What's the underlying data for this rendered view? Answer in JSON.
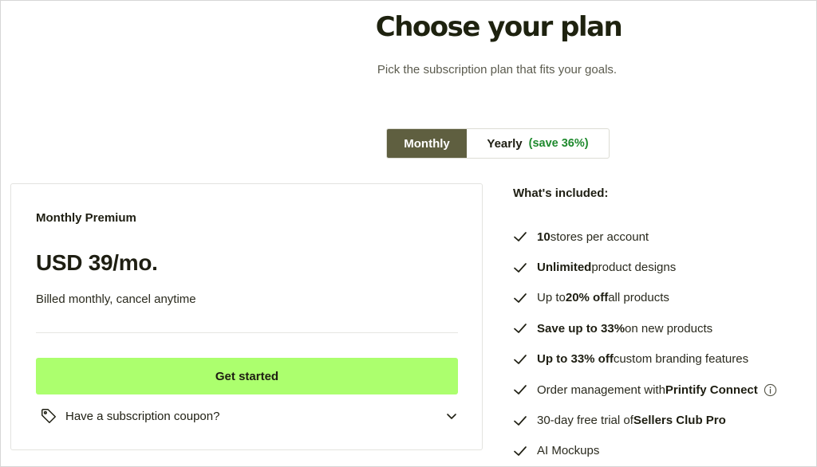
{
  "header": {
    "title": "Choose your plan",
    "subtitle": "Pick the subscription plan that fits your goals."
  },
  "billing_toggle": {
    "monthly_label": "Monthly",
    "yearly_label": "Yearly",
    "yearly_badge": "(save 36%)",
    "selected": "Monthly"
  },
  "plan": {
    "name": "Monthly Premium",
    "price": "USD 39/mo.",
    "billing_note": "Billed monthly, cancel anytime",
    "cta_label": "Get started",
    "coupon_label": "Have a subscription coupon?"
  },
  "included": {
    "heading": "What's included:",
    "features": [
      {
        "bold": "10",
        "rest": " stores per account"
      },
      {
        "bold": "Unlimited",
        "rest": " product designs"
      },
      {
        "pre": "Up to ",
        "bold": "20% off",
        "rest": " all products"
      },
      {
        "bold": "Save up to 33%",
        "rest": " on new products"
      },
      {
        "bold": "Up to 33% off",
        "rest": " custom branding features"
      },
      {
        "pre": "Order management with ",
        "bold": "Printify Connect",
        "rest": ""
      },
      {
        "pre": "30-day free trial of ",
        "bold": "Sellers Club Pro",
        "rest": ""
      },
      {
        "pre": "AI Mockups",
        "bold": "",
        "rest": ""
      }
    ]
  },
  "icons": {
    "check": "check-icon",
    "tag": "tag-icon",
    "chevron": "chevron-down-icon",
    "info": "info-icon"
  },
  "colors": {
    "accent_green_button": "#acff6e",
    "toggle_selected_bg": "#5f5f40",
    "save_badge": "#1f8a2e",
    "title_text": "#1e220f"
  }
}
